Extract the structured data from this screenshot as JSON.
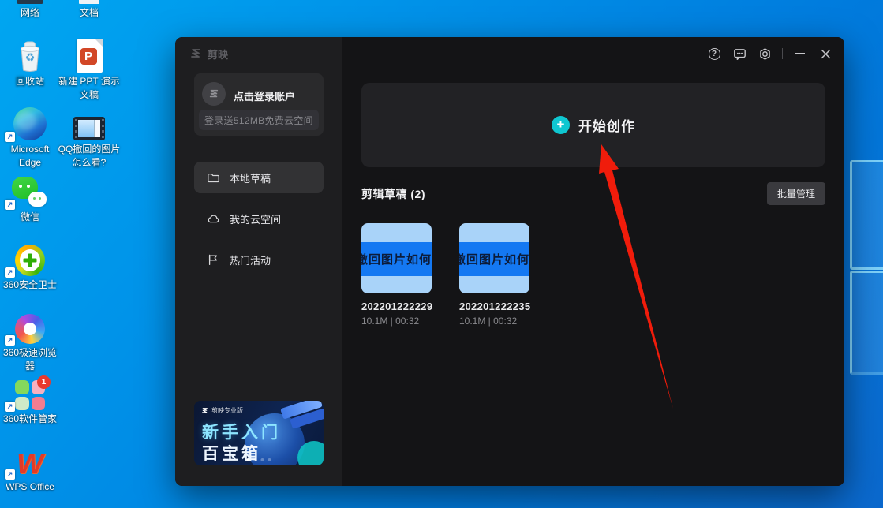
{
  "desktop": {
    "shortcut_glyph": "↗",
    "glyphs": {
      "ppt": "P",
      "wps": "W",
      "recycle": "♻"
    },
    "icons": [
      {
        "label": "网络"
      },
      {
        "label": "文档"
      },
      {
        "label": "回收站"
      },
      {
        "label": "新建 PPT 演示文稿"
      },
      {
        "label": "Microsoft Edge"
      },
      {
        "label": "QQ撤回的图片怎么看?"
      },
      {
        "label": "微信"
      },
      {
        "label": "360安全卫士"
      },
      {
        "label": "360极速浏览器"
      },
      {
        "label": "360软件管家",
        "badge": "1"
      },
      {
        "label": "WPS Office"
      }
    ]
  },
  "window": {
    "title": "剪映",
    "titlebar": {
      "help_glyph": "?"
    },
    "sidebar": {
      "login": {
        "title": "点击登录账户",
        "subtitle": "登录送512MB免费云空间"
      },
      "menu": [
        {
          "label": "本地草稿"
        },
        {
          "label": "我的云空间"
        },
        {
          "label": "热门活动"
        }
      ],
      "banner": {
        "brand": "剪映专业版",
        "line1": "新手入门",
        "line2": "百宝箱"
      }
    },
    "main": {
      "create_plus": "+",
      "create_label": "开始创作",
      "drafts_title": "剪辑草稿 (2)",
      "batch_manage": "批量管理",
      "drafts": [
        {
          "name": "202201222229",
          "meta": "10.1M | 00:32",
          "thumb_text": "撤回图片如何查"
        },
        {
          "name": "202201222235",
          "meta": "10.1M | 00:32",
          "thumb_text": "撤回图片如何查"
        }
      ]
    }
  },
  "colors": {
    "accent_cyan": "#0fc7d1",
    "arrow_red": "#f01c0b",
    "thumb_bg": "#a9d3f9",
    "thumb_band": "#1478f2",
    "wallpaper_blue": "#0087e6"
  }
}
